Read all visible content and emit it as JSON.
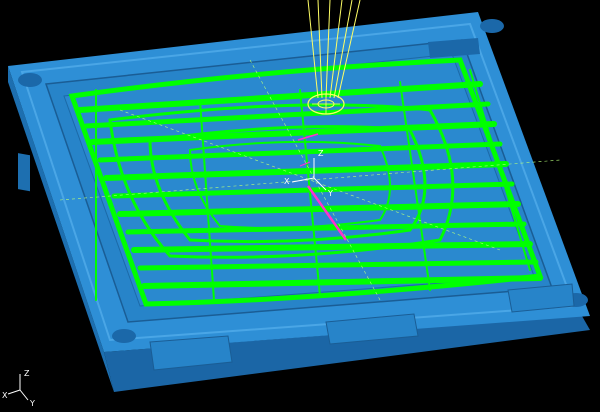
{
  "viewport": {
    "background": "#000000",
    "part_color": "#2e8fd6",
    "toolpath_color": "#00ff00",
    "tool_color": "#ffff66",
    "highlight_color": "#ff33cc"
  },
  "model_axes": {
    "x": "X",
    "y": "Y",
    "z": "Z"
  },
  "view_triad": {
    "x": "X",
    "y": "Y",
    "z": "Z"
  }
}
